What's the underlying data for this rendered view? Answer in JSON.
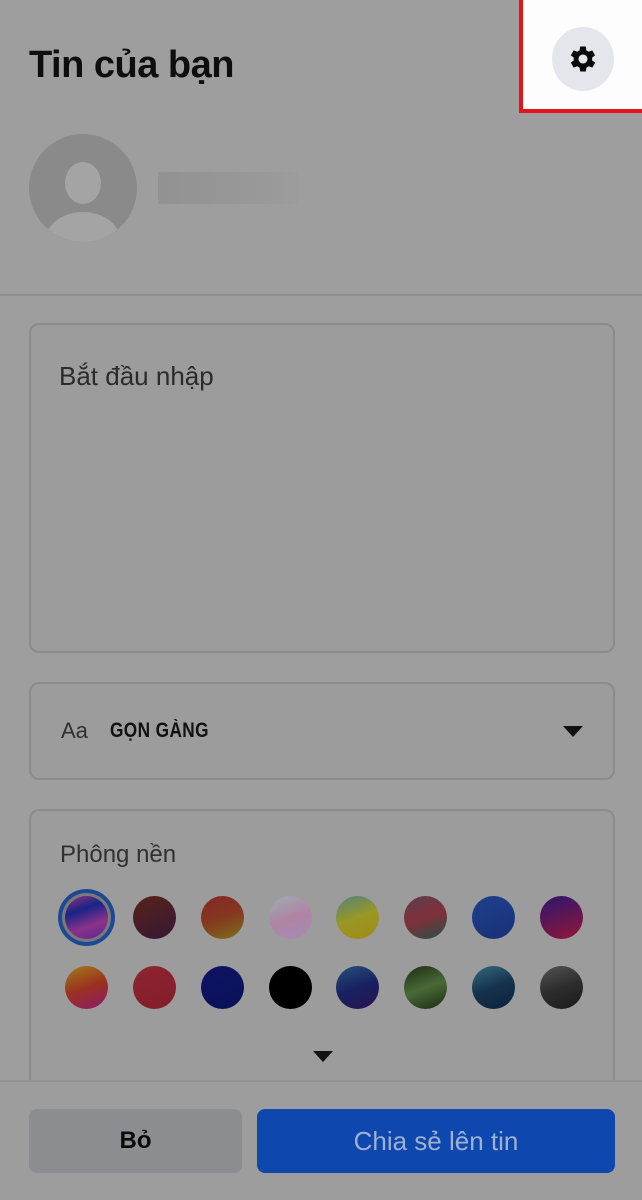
{
  "header": {
    "title": "Tin của bạn",
    "settings_icon": "gear-icon"
  },
  "user": {
    "avatar_icon": "default-avatar-icon",
    "name_redacted": true
  },
  "composer": {
    "placeholder": "Bắt đầu nhập",
    "value": ""
  },
  "font_select": {
    "prefix": "Aa",
    "selected": "GỌN GÀNG",
    "icon": "caret-down-icon"
  },
  "background": {
    "label": "Phông nền",
    "selected_index": 0,
    "swatches": [
      {
        "name": "abstract-pink-blue",
        "colors": [
          "#d23aa8",
          "#1d2dc4",
          "#c23ac0",
          "#7a2bd0"
        ]
      },
      {
        "name": "maroon-purple",
        "colors": [
          "#7a2a1a",
          "#4a1c4a"
        ]
      },
      {
        "name": "red-orange",
        "colors": [
          "#bd2c2c",
          "#b84520",
          "#a49010"
        ]
      },
      {
        "name": "pastel-blobs",
        "colors": [
          "#c8e0ea",
          "#e8a6d6",
          "#d7b0f0"
        ]
      },
      {
        "name": "teal-yellow",
        "colors": [
          "#5eaaa0",
          "#c8c418",
          "#d6b000"
        ]
      },
      {
        "name": "mauve-teal",
        "colors": [
          "#7a4d6a",
          "#b13a47",
          "#286a60"
        ]
      },
      {
        "name": "blue",
        "colors": [
          "#1f52c6",
          "#1a3ea8"
        ]
      },
      {
        "name": "purple-red",
        "colors": [
          "#3c1aa0",
          "#d21646"
        ]
      },
      {
        "name": "yellow-red-pink",
        "colors": [
          "#d8a00e",
          "#d83a1e",
          "#c81a9a"
        ]
      },
      {
        "name": "red",
        "colors": [
          "#c8283c",
          "#b82232"
        ]
      },
      {
        "name": "navy",
        "colors": [
          "#101890",
          "#0a1480"
        ]
      },
      {
        "name": "black",
        "colors": [
          "#000000",
          "#000000"
        ]
      },
      {
        "name": "blue-nebula",
        "colors": [
          "#2a6aa8",
          "#1a2a8a",
          "#3c1470"
        ]
      },
      {
        "name": "green-forest",
        "colors": [
          "#1c3a12",
          "#5a8a3c",
          "#1c3a12"
        ]
      },
      {
        "name": "ocean-blue",
        "colors": [
          "#3a8aa8",
          "#16406a",
          "#0c2c50"
        ]
      },
      {
        "name": "gray-smoke",
        "colors": [
          "#6a6a6a",
          "#3a3a3a",
          "#222222"
        ]
      }
    ],
    "more_icon": "caret-down-icon"
  },
  "footer": {
    "cancel_label": "Bỏ",
    "share_label": "Chia sẻ lên tin"
  },
  "annotation": {
    "highlight_color": "#e3151b",
    "target": "settings-button"
  },
  "colors": {
    "primary": "#0e47ad",
    "overlay": "#9e9e9e"
  }
}
